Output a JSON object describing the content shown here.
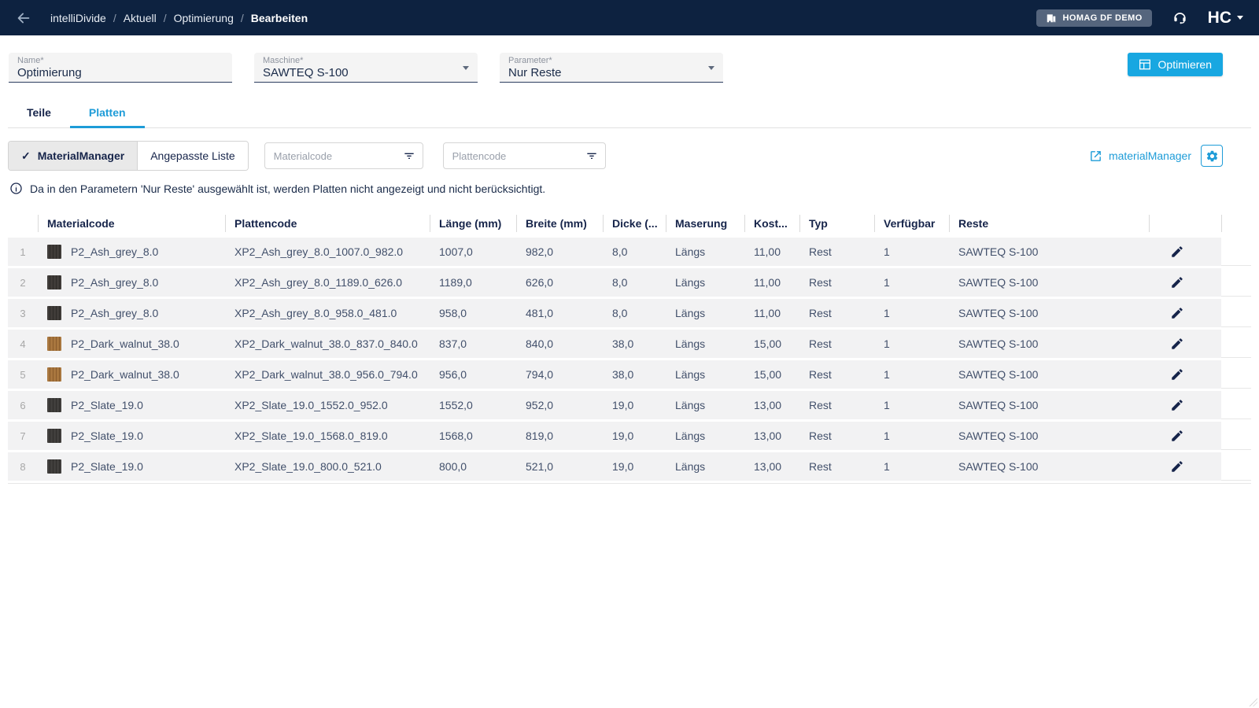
{
  "colors": {
    "navbar_bg": "#0d2240",
    "accent_blue": "#1e9cd8",
    "optimize_button": "#18a7e1",
    "row_bg": "#f2f2f3"
  },
  "navbar": {
    "breadcrumb": [
      "intelliDivide",
      "Aktuell",
      "Optimierung",
      "Bearbeiten"
    ],
    "separator": "/",
    "tenant_button_label": "HOMAG DF DEMO",
    "logo_text": "HC"
  },
  "form": {
    "name_label": "Name*",
    "name_value": "Optimierung",
    "machine_label": "Maschine*",
    "machine_value": "SAWTEQ S-100",
    "parameter_label": "Parameter*",
    "parameter_value": "Nur Reste",
    "optimize_button_label": "Optimieren"
  },
  "tabs": {
    "teile_label": "Teile",
    "platten_label": "Platten",
    "active": "Platten"
  },
  "controls": {
    "toggle_material_manager_label": "MaterialManager",
    "toggle_material_manager_check": "✓",
    "toggle_custom_list_label": "Angepasste Liste",
    "filter_materialcode_placeholder": "Materialcode",
    "filter_plattencode_placeholder": "Plattencode",
    "material_manager_link_label": "materialManager"
  },
  "info_message": "Da in den Parametern 'Nur Reste' ausgewählt ist, werden Platten nicht angezeigt und nicht berücksichtigt.",
  "table": {
    "headers": [
      "Materialcode",
      "Plattencode",
      "Länge (mm)",
      "Breite (mm)",
      "Dicke (...",
      "Maserung",
      "Kost...",
      "Typ",
      "Verfügbar",
      "Reste"
    ],
    "column_keys": [
      "materialcode",
      "plattencode",
      "laenge",
      "breite",
      "dicke",
      "maserung",
      "kosten",
      "typ",
      "verfuegbar",
      "reste"
    ],
    "rows": [
      {
        "num": "1",
        "swatch_base": "#403c39",
        "swatch_grain": "#2d2a27",
        "materialcode": "P2_Ash_grey_8.0",
        "plattencode": "XP2_Ash_grey_8.0_1007.0_982.0",
        "laenge": "1007,0",
        "breite": "982,0",
        "dicke": "8,0",
        "maserung": "Längs",
        "kosten": "11,00",
        "typ": "Rest",
        "verfuegbar": "1",
        "reste": "SAWTEQ S-100"
      },
      {
        "num": "2",
        "swatch_base": "#403c39",
        "swatch_grain": "#2d2a27",
        "materialcode": "P2_Ash_grey_8.0",
        "plattencode": "XP2_Ash_grey_8.0_1189.0_626.0",
        "laenge": "1189,0",
        "breite": "626,0",
        "dicke": "8,0",
        "maserung": "Längs",
        "kosten": "11,00",
        "typ": "Rest",
        "verfuegbar": "1",
        "reste": "SAWTEQ S-100"
      },
      {
        "num": "3",
        "swatch_base": "#403c39",
        "swatch_grain": "#2d2a27",
        "materialcode": "P2_Ash_grey_8.0",
        "plattencode": "XP2_Ash_grey_8.0_958.0_481.0",
        "laenge": "958,0",
        "breite": "481,0",
        "dicke": "8,0",
        "maserung": "Längs",
        "kosten": "11,00",
        "typ": "Rest",
        "verfuegbar": "1",
        "reste": "SAWTEQ S-100"
      },
      {
        "num": "4",
        "swatch_base": "#a9773f",
        "swatch_grain": "#8a5c2c",
        "materialcode": "P2_Dark_walnut_38.0",
        "plattencode": "XP2_Dark_walnut_38.0_837.0_840.0",
        "laenge": "837,0",
        "breite": "840,0",
        "dicke": "38,0",
        "maserung": "Längs",
        "kosten": "15,00",
        "typ": "Rest",
        "verfuegbar": "1",
        "reste": "SAWTEQ S-100"
      },
      {
        "num": "5",
        "swatch_base": "#a9773f",
        "swatch_grain": "#8a5c2c",
        "materialcode": "P2_Dark_walnut_38.0",
        "plattencode": "XP2_Dark_walnut_38.0_956.0_794.0",
        "laenge": "956,0",
        "breite": "794,0",
        "dicke": "38,0",
        "maserung": "Längs",
        "kosten": "15,00",
        "typ": "Rest",
        "verfuegbar": "1",
        "reste": "SAWTEQ S-100"
      },
      {
        "num": "6",
        "swatch_base": "#413f3d",
        "swatch_grain": "#2f2d2b",
        "materialcode": "P2_Slate_19.0",
        "plattencode": "XP2_Slate_19.0_1552.0_952.0",
        "laenge": "1552,0",
        "breite": "952,0",
        "dicke": "19,0",
        "maserung": "Längs",
        "kosten": "13,00",
        "typ": "Rest",
        "verfuegbar": "1",
        "reste": "SAWTEQ S-100"
      },
      {
        "num": "7",
        "swatch_base": "#413f3d",
        "swatch_grain": "#2f2d2b",
        "materialcode": "P2_Slate_19.0",
        "plattencode": "XP2_Slate_19.0_1568.0_819.0",
        "laenge": "1568,0",
        "breite": "819,0",
        "dicke": "19,0",
        "maserung": "Längs",
        "kosten": "13,00",
        "typ": "Rest",
        "verfuegbar": "1",
        "reste": "SAWTEQ S-100"
      },
      {
        "num": "8",
        "swatch_base": "#413f3d",
        "swatch_grain": "#2f2d2b",
        "materialcode": "P2_Slate_19.0",
        "plattencode": "XP2_Slate_19.0_800.0_521.0",
        "laenge": "800,0",
        "breite": "521,0",
        "dicke": "19,0",
        "maserung": "Längs",
        "kosten": "13,00",
        "typ": "Rest",
        "verfuegbar": "1",
        "reste": "SAWTEQ S-100"
      }
    ]
  }
}
